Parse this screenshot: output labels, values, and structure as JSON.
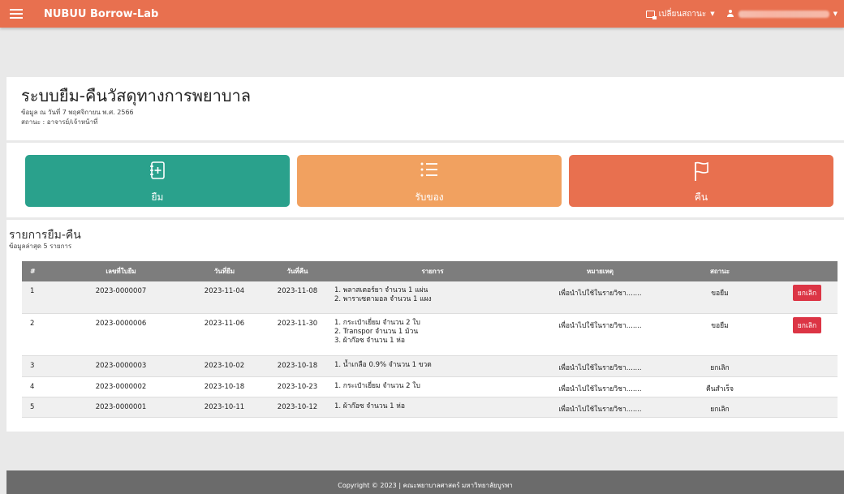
{
  "navbar": {
    "brand": "NUBUU Borrow-Lab",
    "switch_status_label": "เปลี่ยนสถานะ",
    "user_name_hidden": ""
  },
  "header": {
    "title": "ระบบยืม-คืนวัสดุทางการพยาบาล",
    "date_line": "ข้อมูล ณ วันที่ 7 พฤศจิกายน พ.ศ. 2566",
    "status_line": "สถานะ : อาจารย์/เจ้าหน้าที่"
  },
  "actions": {
    "borrow": "ยืม",
    "receive": "รับของ",
    "return": "คืน"
  },
  "list": {
    "title": "รายการยืม-คืน",
    "subtitle": "ข้อมูลล่าสุด 5 รายการ",
    "columns": [
      "#",
      "เลขที่ใบยืม",
      "วันที่ยืม",
      "วันที่คืน",
      "รายการ",
      "หมายเหตุ",
      "สถานะ",
      ""
    ],
    "rows": [
      {
        "num": "1",
        "doc": "2023-0000007",
        "borrow_date": "2023-11-04",
        "return_date": "2023-11-08",
        "items": [
          "1. พลาสเตอร์ยา จำนวน 1 แผ่น",
          "2. พาราเซตามอล จำนวน 1 แผง"
        ],
        "note": "เพื่อนำไปใช้ในรายวิชา.......",
        "status": "ขอยืม",
        "action": "ยกเลิก"
      },
      {
        "num": "2",
        "doc": "2023-0000006",
        "borrow_date": "2023-11-06",
        "return_date": "2023-11-30",
        "items": [
          "1. กระเป๋าเยี่ยม จำนวน 2 ใบ",
          "2. Transpor จำนวน 1 ม้วน",
          "3. ผ้าก๊อซ จำนวน 1 ห่อ"
        ],
        "note": "เพื่อนำไปใช้ในรายวิชา.......",
        "status": "ขอยืม",
        "action": "ยกเลิก"
      },
      {
        "num": "3",
        "doc": "2023-0000003",
        "borrow_date": "2023-10-02",
        "return_date": "2023-10-18",
        "items": [
          "1. น้ำเกลือ 0.9% จำนวน 1 ขวด"
        ],
        "note": "เพื่อนำไปใช้ในรายวิชา.......",
        "status": "ยกเลิก",
        "action": ""
      },
      {
        "num": "4",
        "doc": "2023-0000002",
        "borrow_date": "2023-10-18",
        "return_date": "2023-10-23",
        "items": [
          "1. กระเป๋าเยี่ยม จำนวน 2 ใบ"
        ],
        "note": "เพื่อนำไปใช้ในรายวิชา.......",
        "status": "คืนสำเร็จ",
        "action": ""
      },
      {
        "num": "5",
        "doc": "2023-0000001",
        "borrow_date": "2023-10-11",
        "return_date": "2023-10-12",
        "items": [
          "1. ผ้าก๊อซ จำนวน 1 ห่อ"
        ],
        "note": "เพื่อนำไปใช้ในรายวิชา.......",
        "status": "ยกเลิก",
        "action": ""
      }
    ]
  },
  "footer": {
    "text": "Copyright © 2023 | คณะพยาบาลศาสตร์ มหาวิทยาลัยบูรพา"
  },
  "colors": {
    "navbar": "#e8704f",
    "borrow": "#2aa18c",
    "receive": "#f1a160",
    "return": "#e8704f",
    "cancel": "#dc3545",
    "table_header": "#7d7d7d",
    "footer": "#6b6b6b"
  }
}
